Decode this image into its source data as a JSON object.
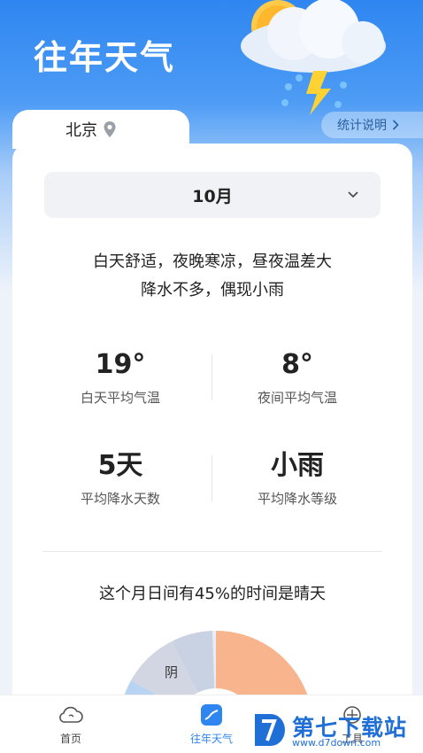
{
  "header": {
    "title": "往年天气",
    "city": "北京",
    "stats_link": "统计说明"
  },
  "month": {
    "selected": "10月"
  },
  "description": {
    "line1": "白天舒适，夜晚寒凉，昼夜温差大",
    "line2": "降水不多，偶现小雨"
  },
  "stats": {
    "day_temp": {
      "value": "19°",
      "label": "白天平均气温"
    },
    "night_temp": {
      "value": "8°",
      "label": "夜间平均气温"
    },
    "rain_days": {
      "value": "5天",
      "label": "平均降水天数"
    },
    "rain_level": {
      "value": "小雨",
      "label": "平均降水等级"
    }
  },
  "sunny_summary": "这个月日间有45%的时间是晴天",
  "pie": {
    "visible_label": "阴",
    "colors": {
      "sunny": "#f8b48c",
      "cloudy": "#c9d2e2",
      "overcast": "#d7dbe6",
      "rain": "#b9d4f2"
    }
  },
  "tabbar": {
    "home": "首页",
    "history": "往年天气",
    "tools": "工具"
  },
  "watermark": {
    "name": "第七下载站",
    "url": "www.d7down.com"
  },
  "colors": {
    "accent": "#2f86f0",
    "header_top": "#2f86f0"
  }
}
